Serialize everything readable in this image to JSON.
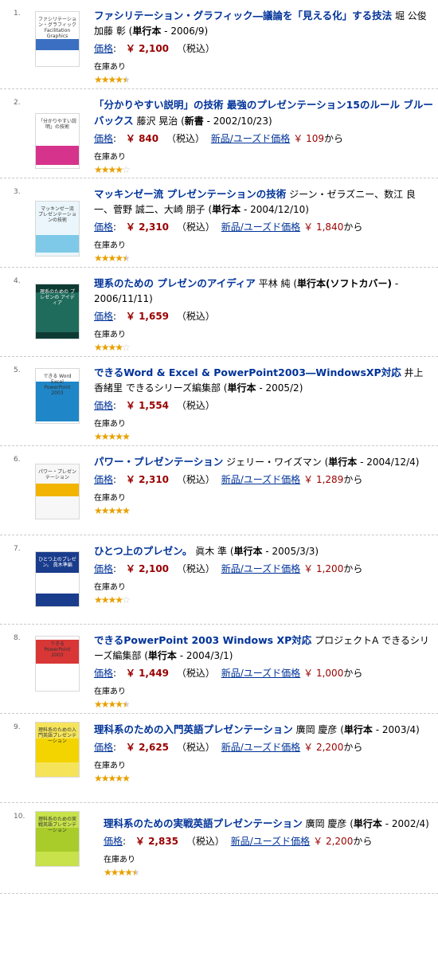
{
  "labels": {
    "price": "価格",
    "colon": ":",
    "tax": "（税込）",
    "used_link": "新品/ユーズド価格",
    "from": "から",
    "stock": "在庫あり",
    "yen": "￥"
  },
  "items": [
    {
      "rank": "1.",
      "title": "ファシリテーション・グラフィック―議論を「見える化」する技法",
      "author": "堀 公俊 加藤 彰",
      "binding": "単行本",
      "date": "- 2006/9)",
      "price": "￥ 2,100",
      "used_price": "",
      "rating": 4.5,
      "cover_text": "ファシリテーション・グラフィック Facilitation Graphics"
    },
    {
      "rank": "2.",
      "title": "「分かりやすい説明」の技術 最強のプレゼンテーション15のルール ブルーバックス",
      "author": "藤沢 晃治",
      "binding": "新書",
      "date": "- 2002/10/23)",
      "price": "￥ 840",
      "used_price": "￥ 109",
      "rating": 4,
      "cover_text": "「分かりやすい説明」の技術"
    },
    {
      "rank": "3.",
      "title": "マッキンゼー流 プレゼンテーションの技術",
      "author": "ジーン・ゼラズニー、数江 良一、菅野 誠二、大崎 朋子",
      "binding": "単行本",
      "date": "- 2004/12/10)",
      "price": "￥ 2,310",
      "used_price": "￥ 1,840",
      "rating": 4.5,
      "cover_text": "マッキンゼー流 プレゼンテーションの技術"
    },
    {
      "rank": "4.",
      "title": "理系のための プレゼンのアイディア",
      "author": "平林 純",
      "binding": "単行本(ソフトカバー)",
      "date": "- 2006/11/11)",
      "price": "￥ 1,659",
      "used_price": "",
      "rating": 4,
      "cover_text": "理系のための プレゼンの アイディア"
    },
    {
      "rank": "5.",
      "title": "できるWord & Excel & PowerPoint2003―WindowsXP対応",
      "author": "井上 香緒里 できるシリーズ編集部",
      "binding": "単行本",
      "date": "- 2005/2)",
      "price": "￥ 1,554",
      "used_price": "",
      "rating": 5,
      "cover_text": "できる Word Excel PowerPoint 2003"
    },
    {
      "rank": "6.",
      "title": "パワー・プレゼンテーション",
      "author": "ジェリー・ワイズマン",
      "binding": "単行本",
      "date": "- 2004/12/4)",
      "price": "￥ 2,310",
      "used_price": "￥ 1,289",
      "rating": 5,
      "cover_text": "パワー・プレゼンテーション"
    },
    {
      "rank": "7.",
      "title": "ひとつ上のプレゼン。",
      "author": "眞木 準",
      "binding": "単行本",
      "date": "- 2005/3/3)",
      "price": "￥ 2,100",
      "used_price": "￥ 1,200",
      "rating": 4,
      "cover_text": "ひとつ上のプレゼン。 眞木準編"
    },
    {
      "rank": "8.",
      "title": "できるPowerPoint 2003 Windows XP対応",
      "author": "プロジェクトA できるシリーズ編集部",
      "binding": "単行本",
      "date": "- 2004/3/1)",
      "price": "￥ 1,449",
      "used_price": "￥ 1,000",
      "rating": 4.5,
      "cover_text": "できる PowerPoint 2003"
    },
    {
      "rank": "9.",
      "title": "理科系のための入門英語プレゼンテーション",
      "author": "廣岡 慶彦",
      "binding": "単行本",
      "date": "- 2003/4)",
      "price": "￥ 2,625",
      "used_price": "￥ 2,200",
      "rating": 5,
      "cover_text": "理科系のための入門英語プレゼンテーション"
    },
    {
      "rank": "10.",
      "title": "理科系のための実戦英語プレゼンテーション",
      "author": "廣岡 慶彦",
      "binding": "単行本",
      "date": "- 2002/4)",
      "price": "￥ 2,835",
      "used_price": "￥ 2,200",
      "rating": 4.5,
      "cover_text": "理科系のための実戦英語プレゼンテーション"
    }
  ],
  "colors": {
    "link": "#003399",
    "price": "#990000",
    "star": "#e8a000"
  }
}
